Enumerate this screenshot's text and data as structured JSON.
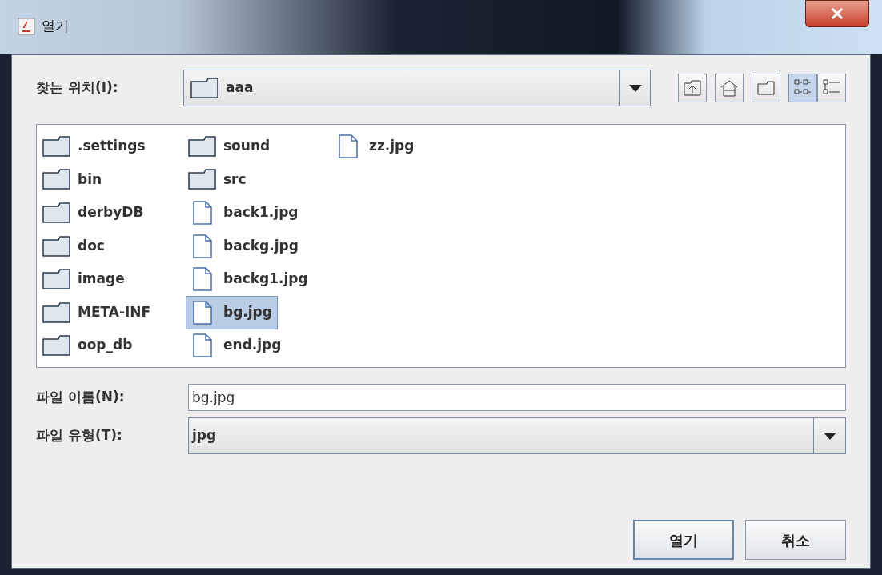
{
  "window": {
    "title": "열기"
  },
  "look_in": {
    "label": "찾는 위치(I):",
    "value": "aaa"
  },
  "toolbar": [
    {
      "kind": "up",
      "selected": false
    },
    {
      "kind": "home",
      "selected": false
    },
    {
      "kind": "new-folder",
      "selected": false
    },
    {
      "kind": "list",
      "selected": true
    },
    {
      "kind": "details",
      "selected": false
    }
  ],
  "files": [
    {
      "name": ".settings",
      "kind": "folder",
      "selected": false
    },
    {
      "name": "bin",
      "kind": "folder",
      "selected": false
    },
    {
      "name": "derbyDB",
      "kind": "folder",
      "selected": false
    },
    {
      "name": "doc",
      "kind": "folder",
      "selected": false
    },
    {
      "name": "image",
      "kind": "folder",
      "selected": false
    },
    {
      "name": "META-INF",
      "kind": "folder",
      "selected": false
    },
    {
      "name": "oop_db",
      "kind": "folder",
      "selected": false
    },
    {
      "name": "sound",
      "kind": "folder",
      "selected": false
    },
    {
      "name": "src",
      "kind": "folder",
      "selected": false
    },
    {
      "name": "back1.jpg",
      "kind": "file",
      "selected": false
    },
    {
      "name": "backg.jpg",
      "kind": "file",
      "selected": false
    },
    {
      "name": "backg1.jpg",
      "kind": "file",
      "selected": false
    },
    {
      "name": "bg.jpg",
      "kind": "file",
      "selected": true
    },
    {
      "name": "end.jpg",
      "kind": "file",
      "selected": false
    },
    {
      "name": "zz.jpg",
      "kind": "file",
      "selected": false
    }
  ],
  "file_name": {
    "label": "파일 이름(N):",
    "value": "bg.jpg"
  },
  "file_type": {
    "label": "파일 유형(T):",
    "value": "jpg"
  },
  "buttons": [
    "열기",
    "취소"
  ]
}
